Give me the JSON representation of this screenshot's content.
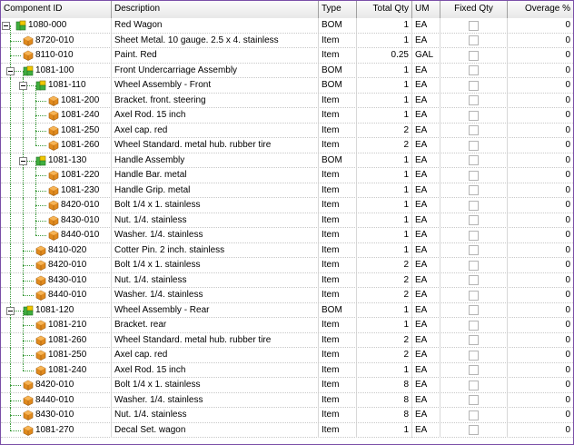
{
  "columns": [
    {
      "key": "id",
      "label": "Component ID"
    },
    {
      "key": "desc",
      "label": "Description"
    },
    {
      "key": "type",
      "label": "Type"
    },
    {
      "key": "qty",
      "label": "Total Qty"
    },
    {
      "key": "um",
      "label": "UM"
    },
    {
      "key": "fixed",
      "label": "Fixed Qty"
    },
    {
      "key": "over",
      "label": "Overage %"
    }
  ],
  "rows": [
    {
      "level": 0,
      "id": "1080-000",
      "desc": "Red Wagon",
      "type": "BOM",
      "qty": "1",
      "um": "EA",
      "over": "0",
      "icon": "bom-icon",
      "expandable": true
    },
    {
      "level": 1,
      "id": "8720-010",
      "desc": "Sheet Metal. 10 gauge. 2.5 x 4. stainless",
      "type": "Item",
      "qty": "1",
      "um": "EA",
      "over": "0",
      "icon": "item-icon"
    },
    {
      "level": 1,
      "id": "8110-010",
      "desc": "Paint. Red",
      "type": "Item",
      "qty": "0.25",
      "um": "GAL",
      "over": "0",
      "icon": "item-icon"
    },
    {
      "level": 1,
      "id": "1081-100",
      "desc": "Front Undercarriage Assembly",
      "type": "BOM",
      "qty": "1",
      "um": "EA",
      "over": "0",
      "icon": "bom-icon",
      "expandable": true
    },
    {
      "level": 2,
      "id": "1081-110",
      "desc": "Wheel Assembly - Front",
      "type": "BOM",
      "qty": "1",
      "um": "EA",
      "over": "0",
      "icon": "bom-icon",
      "expandable": true
    },
    {
      "level": 3,
      "id": "1081-200",
      "desc": "Bracket. front. steering",
      "type": "Item",
      "qty": "1",
      "um": "EA",
      "over": "0",
      "icon": "item-icon"
    },
    {
      "level": 3,
      "id": "1081-240",
      "desc": "Axel Rod. 15 inch",
      "type": "Item",
      "qty": "1",
      "um": "EA",
      "over": "0",
      "icon": "item-icon"
    },
    {
      "level": 3,
      "id": "1081-250",
      "desc": "Axel cap. red",
      "type": "Item",
      "qty": "2",
      "um": "EA",
      "over": "0",
      "icon": "item-icon"
    },
    {
      "level": 3,
      "id": "1081-260",
      "desc": "Wheel Standard. metal hub. rubber tire",
      "type": "Item",
      "qty": "2",
      "um": "EA",
      "over": "0",
      "icon": "item-icon"
    },
    {
      "level": 2,
      "id": "1081-130",
      "desc": "Handle Assembly",
      "type": "BOM",
      "qty": "1",
      "um": "EA",
      "over": "0",
      "icon": "bom-icon",
      "expandable": true
    },
    {
      "level": 3,
      "id": "1081-220",
      "desc": "Handle Bar. metal",
      "type": "Item",
      "qty": "1",
      "um": "EA",
      "over": "0",
      "icon": "item-icon"
    },
    {
      "level": 3,
      "id": "1081-230",
      "desc": "Handle Grip. metal",
      "type": "Item",
      "qty": "1",
      "um": "EA",
      "over": "0",
      "icon": "item-icon"
    },
    {
      "level": 3,
      "id": "8420-010",
      "desc": "Bolt  1/4 x 1. stainless",
      "type": "Item",
      "qty": "1",
      "um": "EA",
      "over": "0",
      "icon": "item-icon"
    },
    {
      "level": 3,
      "id": "8430-010",
      "desc": "Nut. 1/4. stainless",
      "type": "Item",
      "qty": "1",
      "um": "EA",
      "over": "0",
      "icon": "item-icon"
    },
    {
      "level": 3,
      "id": "8440-010",
      "desc": "Washer. 1/4. stainless",
      "type": "Item",
      "qty": "1",
      "um": "EA",
      "over": "0",
      "icon": "item-icon"
    },
    {
      "level": 2,
      "id": "8410-020",
      "desc": "Cotter Pin. 2 inch. stainless",
      "type": "Item",
      "qty": "1",
      "um": "EA",
      "over": "0",
      "icon": "item-icon"
    },
    {
      "level": 2,
      "id": "8420-010",
      "desc": "Bolt  1/4 x 1. stainless",
      "type": "Item",
      "qty": "2",
      "um": "EA",
      "over": "0",
      "icon": "item-icon"
    },
    {
      "level": 2,
      "id": "8430-010",
      "desc": "Nut. 1/4. stainless",
      "type": "Item",
      "qty": "2",
      "um": "EA",
      "over": "0",
      "icon": "item-icon"
    },
    {
      "level": 2,
      "id": "8440-010",
      "desc": "Washer. 1/4. stainless",
      "type": "Item",
      "qty": "2",
      "um": "EA",
      "over": "0",
      "icon": "item-icon"
    },
    {
      "level": 1,
      "id": "1081-120",
      "desc": "Wheel Assembly - Rear",
      "type": "BOM",
      "qty": "1",
      "um": "EA",
      "over": "0",
      "icon": "bom-icon",
      "expandable": true
    },
    {
      "level": 2,
      "id": "1081-210",
      "desc": "Bracket. rear",
      "type": "Item",
      "qty": "1",
      "um": "EA",
      "over": "0",
      "icon": "item-icon"
    },
    {
      "level": 2,
      "id": "1081-260",
      "desc": "Wheel Standard. metal hub. rubber tire",
      "type": "Item",
      "qty": "2",
      "um": "EA",
      "over": "0",
      "icon": "item-icon"
    },
    {
      "level": 2,
      "id": "1081-250",
      "desc": "Axel cap. red",
      "type": "Item",
      "qty": "2",
      "um": "EA",
      "over": "0",
      "icon": "item-icon"
    },
    {
      "level": 2,
      "id": "1081-240",
      "desc": "Axel Rod. 15 inch",
      "type": "Item",
      "qty": "1",
      "um": "EA",
      "over": "0",
      "icon": "item-icon"
    },
    {
      "level": 1,
      "id": "8420-010",
      "desc": "Bolt  1/4 x 1. stainless",
      "type": "Item",
      "qty": "8",
      "um": "EA",
      "over": "0",
      "icon": "item-icon"
    },
    {
      "level": 1,
      "id": "8440-010",
      "desc": "Washer. 1/4. stainless",
      "type": "Item",
      "qty": "8",
      "um": "EA",
      "over": "0",
      "icon": "item-icon"
    },
    {
      "level": 1,
      "id": "8430-010",
      "desc": "Nut. 1/4. stainless",
      "type": "Item",
      "qty": "8",
      "um": "EA",
      "over": "0",
      "icon": "item-icon"
    },
    {
      "level": 1,
      "id": "1081-270",
      "desc": "Decal Set. wagon",
      "type": "Item",
      "qty": "1",
      "um": "EA",
      "over": "0",
      "icon": "item-icon"
    }
  ],
  "colors": {
    "tree_line": "#3a9a3a",
    "item_icon": "#e08a1e",
    "bom_icon_green": "#3fae3f",
    "bom_icon_yellow": "#f0c800",
    "window_border": "#7a4fa8"
  }
}
